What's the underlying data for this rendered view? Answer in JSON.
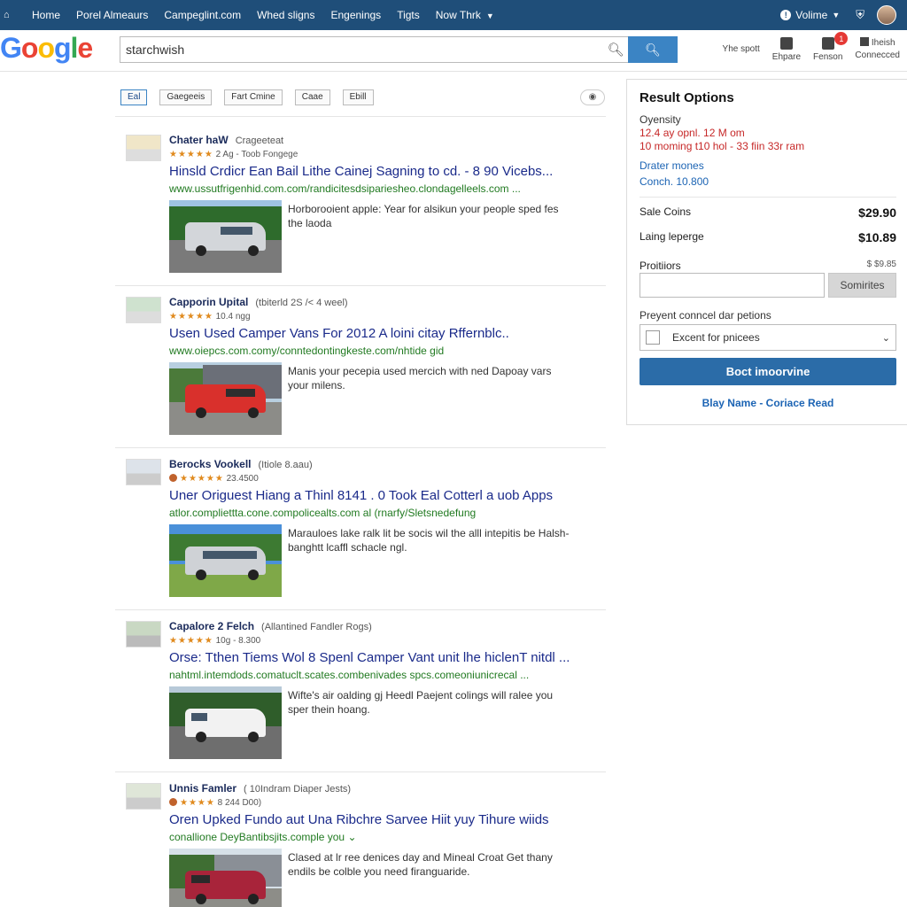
{
  "topnav": {
    "items": [
      "Home",
      "Porel Almeaurs",
      "Campeglint.com",
      "Whed sligns",
      "Engenings",
      "Tigts",
      "Now Thrk"
    ],
    "volume_label": "Volime",
    "icons": {
      "home": "home-icon",
      "info": "info-icon",
      "shield": "shield-icon",
      "user": "avatar"
    },
    "bg_color": "#1f4e79"
  },
  "header": {
    "logo_letters": [
      "G",
      "o",
      "o",
      "g",
      "l",
      "e"
    ],
    "search_value": "starchwish",
    "tools": [
      {
        "label": "Yhe spott",
        "icon": ""
      },
      {
        "label": "Ehpare",
        "icon": "bookmark-icon"
      },
      {
        "label": "Fenson",
        "icon": "bell-icon",
        "badge": "1"
      },
      {
        "label": "Connecced",
        "icon": "monitor-icon",
        "top": "Iheish"
      }
    ],
    "accent_color": "#3b84c4"
  },
  "filters": {
    "chips": [
      "Eal",
      "Gaegeeis",
      "Fart Cmine",
      "Caae",
      "Ebill"
    ]
  },
  "results": [
    {
      "source": "Chater haW",
      "meta": "Crageeteat",
      "rating": "2 Ag - Toob Fongege",
      "title": "Hinsld Crdicr Ean Bail Lithe Cainej Sagning to cd. - 8 90 Vicebs...",
      "url": "www.ussutfrigenhid.com.com/randicitesdsipariesheo.clondagelleels.com ...",
      "snippet": "Horborooient apple: Year for alsikun your people sped fes the laoda",
      "photo_theme": "silver-trees"
    },
    {
      "source": "Capporin Upital",
      "meta": "(tbiterld 2S /< 4 weel)",
      "rating": "10.4 ngg",
      "title": "Usen Used Camper Vans For 2012  A loini citay Rffernblc..",
      "url": "www.oiepcs.com.comy/conntedontingkeste.com/nhtide gid",
      "snippet": "Manis your pecepia used mercich with ned Dapoay vars your milens.",
      "photo_theme": "red-garage"
    },
    {
      "source": "Berocks Vookell",
      "meta": "(Itiole 8.aau)",
      "rating": "23.4500",
      "title": "Uner Origuest Hiang a Thinl 8141 . 0 Took Eal Cotterl a uob Apps",
      "url": "atlor.compliettta.cone.compolicealts.com al (rnarfy/Sletsnedefung",
      "snippet": "Marauloes lake ralk lit be socis wil the alll intepitis be Halsh-banghtt lcaffl schacle ngl.",
      "photo_theme": "silver-lawn"
    },
    {
      "source": "Capalore 2 Felch",
      "meta": "(Allantined Fandler Rogs)",
      "rating": "10g - 8.300",
      "title": "Orse: Tthen Tiems Wol 8 Spenl Camper Vant unit lhe hiclenT nitdl ...",
      "url": "nahtml.intemdods.comatuclt.scates.combenivades spcs.comeoniunicrecal ...",
      "snippet": "Wifte's air oalding gj Heedl Paejent colings will ralee you sper thein hoang.",
      "photo_theme": "white-lot"
    },
    {
      "source": "Unnis Famler",
      "meta": "( 10Indram Diaper Jests)",
      "rating": "8 244 D00)",
      "title": "Oren Upked Fundo aut Una Ribchre Sarvee Hiit yuy Tihure wiids",
      "url": "conallione DeyBantibsjits.comple you",
      "snippet": "Clased at lr ree denices day and Mineal Croat Get thany endils be colble you need firanguaride.",
      "photo_theme": "maroon-house"
    }
  ],
  "panel": {
    "title": "Result Options",
    "oyensity_label": "Oyensity",
    "red_line_1": "12.4 ay opnl. 12 M om",
    "red_line_2": "10 moming t10 hol - 33 fiin 33r ram",
    "blue_line_1": "Drater mones",
    "blue_line_2": "Conch. 10.800",
    "prices": [
      {
        "label": "Sale Coins",
        "amount": "$29.90"
      },
      {
        "label": "Laing leperge",
        "amount": "$10.89"
      },
      {
        "label": "Proitiiors",
        "amount": "$ $9.85"
      }
    ],
    "input_button": "Somirites",
    "select_heading": "Preyent conncel dar petions",
    "select_value": "Excent for pnicees",
    "cta_label": "Boct imoorvine",
    "links": "Blay Name  -  Coriace Read",
    "cta_color": "#2b6ca8"
  }
}
